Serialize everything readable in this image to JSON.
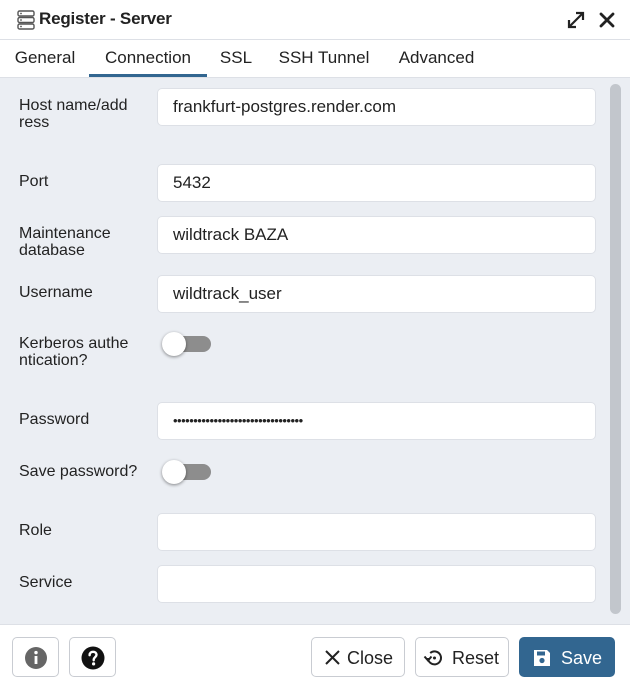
{
  "window": {
    "title": "Register - Server",
    "icons": [
      "server-icon",
      "maximize-icon",
      "close-icon"
    ]
  },
  "tabs": [
    {
      "label": "General",
      "active": false
    },
    {
      "label": "Connection",
      "active": true
    },
    {
      "label": "SSL",
      "active": false
    },
    {
      "label": "SSH Tunnel",
      "active": false
    },
    {
      "label": "Advanced",
      "active": false
    }
  ],
  "form": {
    "host": {
      "label": "Host name/address",
      "value": "frankfurt-postgres.render.com"
    },
    "port": {
      "label": "Port",
      "value": "5432"
    },
    "maintenance_db": {
      "label": "Maintenance database",
      "value": "wildtrack BAZA"
    },
    "username": {
      "label": "Username",
      "value": "wildtrack_user"
    },
    "kerberos": {
      "label": "Kerberos authentication?",
      "enabled": false
    },
    "password": {
      "label": "Password",
      "value": "••••••••••••••••••••••••••••••••"
    },
    "save_password": {
      "label": "Save password?",
      "enabled": false
    },
    "role": {
      "label": "Role",
      "value": ""
    },
    "service": {
      "label": "Service",
      "value": ""
    }
  },
  "footer": {
    "info_icon": "info-icon",
    "help_icon": "help-icon",
    "close_label": "Close",
    "reset_label": "Reset",
    "save_label": "Save"
  },
  "colors": {
    "accent": "#326690",
    "form_background": "#ebeef3",
    "toggle_off": "#8d8d8d"
  }
}
